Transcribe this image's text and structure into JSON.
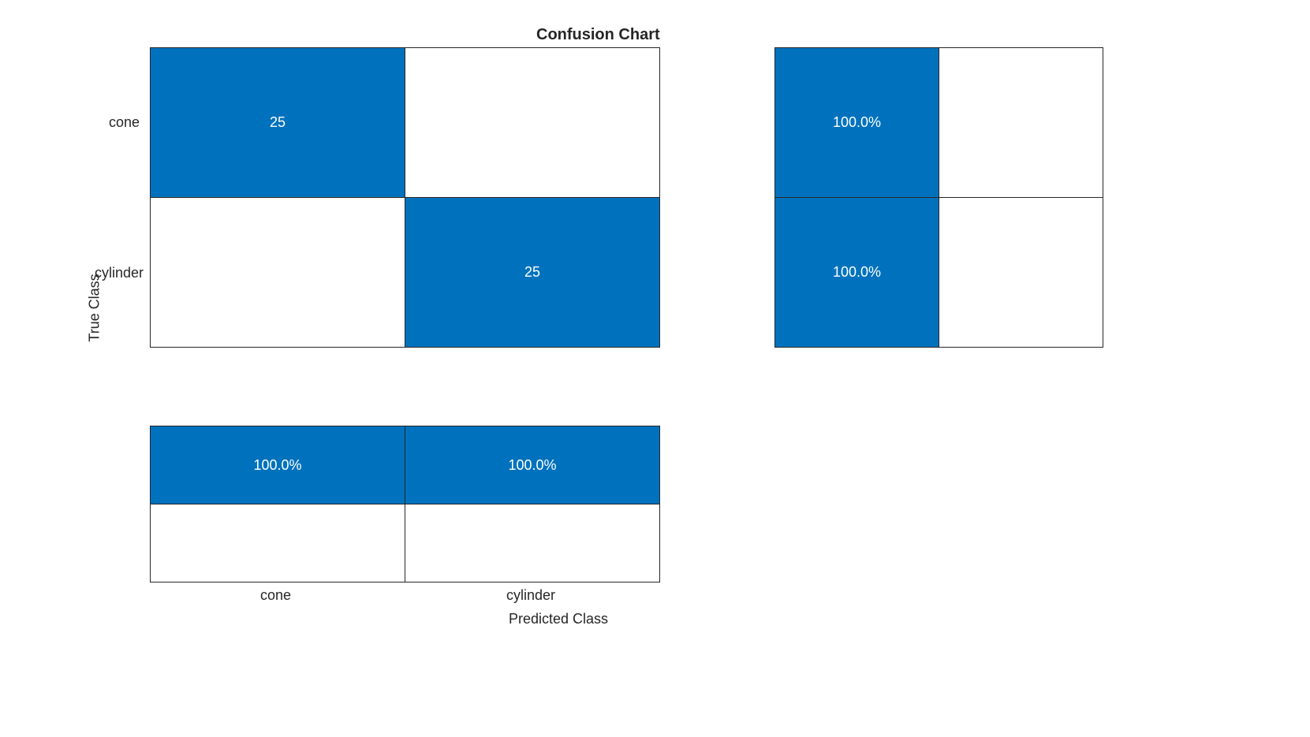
{
  "chart_data": {
    "type": "heatmap",
    "title": "Confusion Chart",
    "xlabel": "Predicted Class",
    "ylabel": "True Class",
    "classes": [
      "cone",
      "cylinder"
    ],
    "matrix": [
      [
        25,
        0
      ],
      [
        0,
        25
      ]
    ],
    "row_summary": {
      "values": [
        [
          "100.0%",
          ""
        ],
        [
          "100.0%",
          ""
        ]
      ]
    },
    "column_summary": {
      "values": [
        [
          "100.0%",
          "100.0%"
        ],
        [
          "",
          ""
        ]
      ]
    }
  }
}
